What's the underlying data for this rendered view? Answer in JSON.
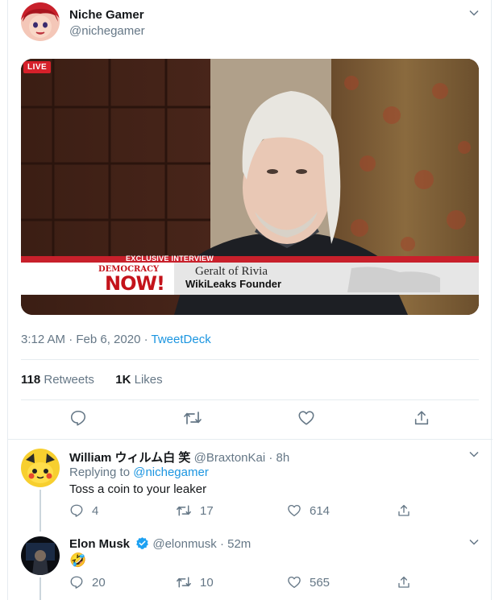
{
  "main_tweet": {
    "display_name": "Niche Gamer",
    "handle": "@nichegamer",
    "timestamp": "3:12 AM · Feb 6, 2020",
    "separator": " · ",
    "source": "TweetDeck",
    "retweets_count": "118",
    "retweets_label": " Retweets",
    "likes_count": "1K",
    "likes_label": " Likes",
    "media": {
      "live_badge": "LIVE",
      "banner_text": "EXCLUSIVE INTERVIEW",
      "show_logo_top": "DEMOCRACY",
      "show_logo_bottom": "NOW!",
      "guest_name": "Geralt of Rivia",
      "guest_title": "WikiLeaks Founder"
    }
  },
  "replies": [
    {
      "display_name": "William ウィルム白 笑",
      "handle_time": " @BraxtonKai · 8h",
      "replying_prefix": "Replying to ",
      "replying_to": "@nichegamer",
      "text": "Toss a coin to your leaker",
      "reply_count": "4",
      "retweet_count": "17",
      "like_count": "614"
    },
    {
      "display_name": "Elon Musk",
      "handle_time": " @elonmusk · 52m",
      "text": "🤣",
      "reply_count": "20",
      "retweet_count": "10",
      "like_count": "565"
    }
  ],
  "colors": {
    "accent": "#1b95e0",
    "muted": "#657786",
    "text": "#14171a",
    "border": "#e6ecf0",
    "live_red": "#d6202a"
  },
  "icons": [
    "chevron-down-icon",
    "reply-icon",
    "retweet-icon",
    "like-icon",
    "share-icon",
    "verified-icon"
  ]
}
